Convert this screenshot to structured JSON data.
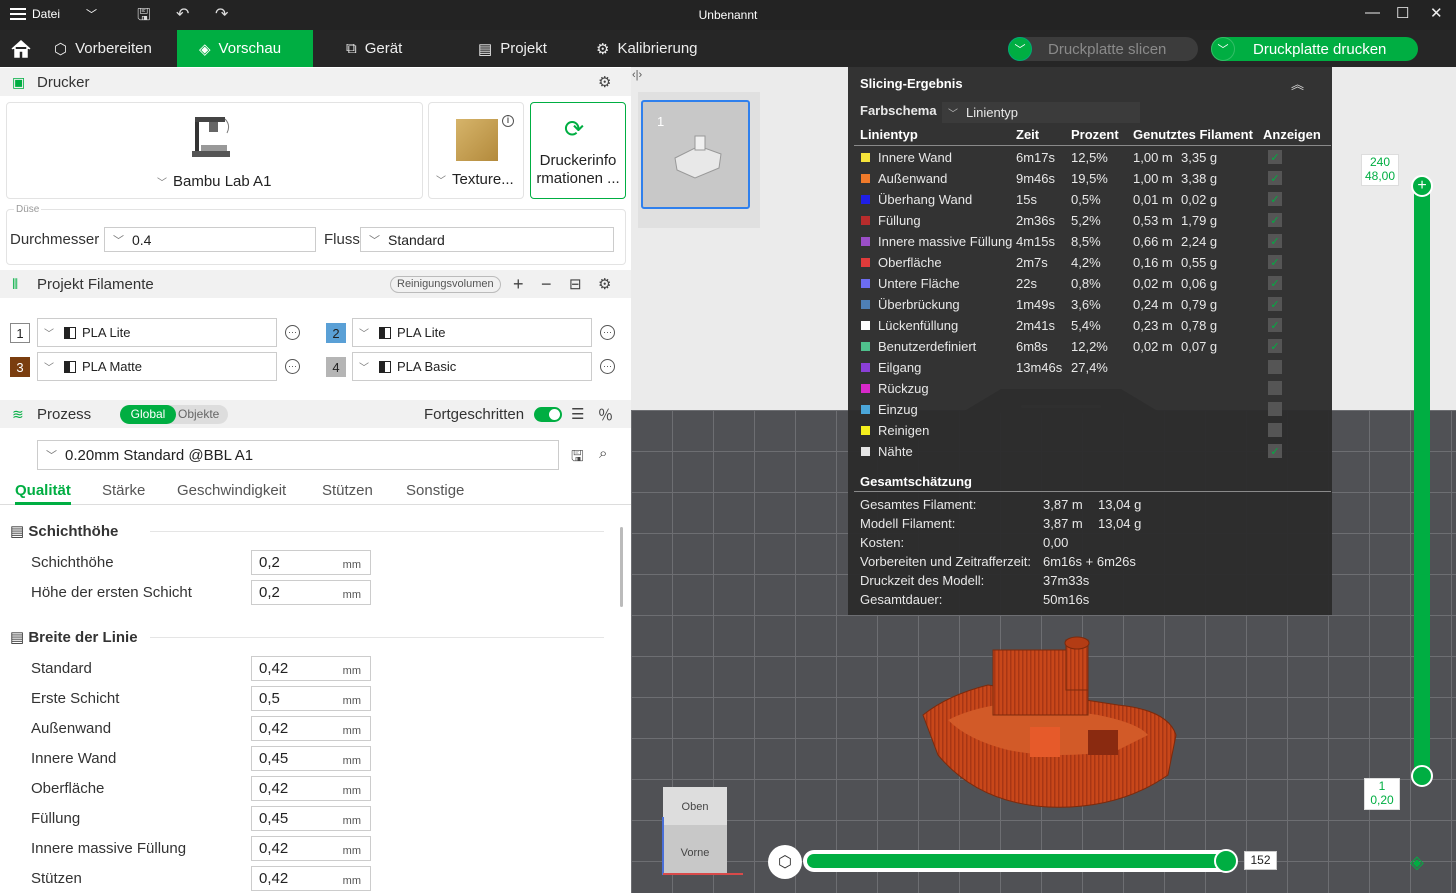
{
  "titlebar": {
    "menu_label": "Datei",
    "title": "Unbenannt"
  },
  "nav": {
    "items": [
      {
        "label": "Vorbereiten"
      },
      {
        "label": "Vorschau"
      },
      {
        "label": "Gerät"
      },
      {
        "label": "Projekt"
      },
      {
        "label": "Kalibrierung"
      }
    ],
    "slice_label": "Druckplatte slicen",
    "print_label": "Druckplatte drucken"
  },
  "printer": {
    "header": "Drucker",
    "name": "Bambu Lab A1",
    "plate": "Texture...",
    "info_label_1": "Druckerinfo",
    "info_label_2": "rmationen ..."
  },
  "nozzle": {
    "group_label": "Düse",
    "diameter_label": "Durchmesser",
    "diameter_value": "0.4",
    "flow_label": "Fluss",
    "flow_value": "Standard"
  },
  "filaments": {
    "header": "Projekt Filamente",
    "purge_label": "Reinigungsvolumen",
    "items": [
      {
        "num": "1",
        "name": "PLA Lite",
        "color": "#ffffff"
      },
      {
        "num": "2",
        "name": "PLA Lite",
        "color": "#5aa0d6"
      },
      {
        "num": "3",
        "name": "PLA Matte",
        "color": "#7a3d0f"
      },
      {
        "num": "4",
        "name": "PLA Basic",
        "color": "#b5b5b5"
      }
    ]
  },
  "process": {
    "header": "Prozess",
    "toggle_global": "Global",
    "toggle_objects": "Objekte",
    "advanced_label": "Fortgeschritten",
    "profile": "0.20mm Standard @BBL A1",
    "tabs": [
      "Qualität",
      "Stärke",
      "Geschwindigkeit",
      "Stützen",
      "Sonstige"
    ],
    "groups": [
      {
        "title": "Schichthöhe",
        "rows": [
          {
            "label": "Schichthöhe",
            "value": "0,2",
            "unit": "mm"
          },
          {
            "label": "Höhe der ersten Schicht",
            "value": "0,2",
            "unit": "mm"
          }
        ]
      },
      {
        "title": "Breite der Linie",
        "rows": [
          {
            "label": "Standard",
            "value": "0,42",
            "unit": "mm"
          },
          {
            "label": "Erste Schicht",
            "value": "0,5",
            "unit": "mm"
          },
          {
            "label": "Außenwand",
            "value": "0,42",
            "unit": "mm"
          },
          {
            "label": "Innere Wand",
            "value": "0,45",
            "unit": "mm"
          },
          {
            "label": "Oberfläche",
            "value": "0,42",
            "unit": "mm"
          },
          {
            "label": "Füllung",
            "value": "0,45",
            "unit": "mm"
          },
          {
            "label": "Innere massive Füllung",
            "value": "0,42",
            "unit": "mm"
          },
          {
            "label": "Stützen",
            "value": "0,42",
            "unit": "mm"
          }
        ]
      }
    ]
  },
  "viewport": {
    "plate_number": "1",
    "cube_top": "Oben",
    "cube_front": "Vorne",
    "layer_top_num": "240",
    "layer_top_height": "48,00",
    "layer_bottom_num": "1",
    "layer_bottom_height": "0,20",
    "move_value": "152"
  },
  "result": {
    "title": "Slicing-Ergebnis",
    "scheme_label": "Farbschema",
    "scheme_value": "Linientyp",
    "columns": [
      "Linientyp",
      "Zeit",
      "Prozent",
      "Genutztes Filament",
      "Anzeigen"
    ],
    "rows": [
      {
        "name": "Innere Wand",
        "color": "#f5e33a",
        "time": "6m17s",
        "pct": "12,5%",
        "m": "1,00 m",
        "g": "3,35 g",
        "show": true
      },
      {
        "name": "Außenwand",
        "color": "#f07a2a",
        "time": "9m46s",
        "pct": "19,5%",
        "m": "1,00 m",
        "g": "3,38 g",
        "show": true
      },
      {
        "name": "Überhang Wand",
        "color": "#1f1fe6",
        "time": "15s",
        "pct": "0,5%",
        "m": "0,01 m",
        "g": "0,02 g",
        "show": true
      },
      {
        "name": "Füllung",
        "color": "#b82c2c",
        "time": "2m36s",
        "pct": "5,2%",
        "m": "0,53 m",
        "g": "1,79 g",
        "show": true
      },
      {
        "name": "Innere massive Füllung",
        "color": "#9b4fc8",
        "time": "4m15s",
        "pct": "8,5%",
        "m": "0,66 m",
        "g": "2,24 g",
        "show": true
      },
      {
        "name": "Oberfläche",
        "color": "#e03b3b",
        "time": "2m7s",
        "pct": "4,2%",
        "m": "0,16 m",
        "g": "0,55 g",
        "show": true
      },
      {
        "name": "Untere Fläche",
        "color": "#6c6cf0",
        "time": "22s",
        "pct": "0,8%",
        "m": "0,02 m",
        "g": "0,06 g",
        "show": true
      },
      {
        "name": "Überbrückung",
        "color": "#4e7fb5",
        "time": "1m49s",
        "pct": "3,6%",
        "m": "0,24 m",
        "g": "0,79 g",
        "show": true
      },
      {
        "name": "Lückenfüllung",
        "color": "#ffffff",
        "time": "2m41s",
        "pct": "5,4%",
        "m": "0,23 m",
        "g": "0,78 g",
        "show": true
      },
      {
        "name": "Benutzerdefiniert",
        "color": "#4fc08c",
        "time": "6m8s",
        "pct": "12,2%",
        "m": "0,02 m",
        "g": "0,07 g",
        "show": true
      },
      {
        "name": "Eilgang",
        "color": "#8a3fd6",
        "time": "13m46s",
        "pct": "27,4%",
        "m": "",
        "g": "",
        "show": false
      },
      {
        "name": "Rückzug",
        "color": "#d829c9",
        "time": "",
        "pct": "",
        "m": "",
        "g": "",
        "show": false
      },
      {
        "name": "Einzug",
        "color": "#4ba6d9",
        "time": "",
        "pct": "",
        "m": "",
        "g": "",
        "show": false
      },
      {
        "name": "Reinigen",
        "color": "#f4ee1d",
        "time": "",
        "pct": "",
        "m": "",
        "g": "",
        "show": false
      },
      {
        "name": "Nähte",
        "color": "#e6e6e6",
        "time": "",
        "pct": "",
        "m": "",
        "g": "",
        "show": true
      }
    ],
    "totals_title": "Gesamtschätzung",
    "totals": [
      {
        "k": "Gesamtes Filament:",
        "v1": "3,87 m",
        "v2": "13,04 g"
      },
      {
        "k": "Modell Filament:",
        "v1": "3,87 m",
        "v2": "13,04 g"
      },
      {
        "k": "Kosten:",
        "v1": "0,00",
        "v2": ""
      },
      {
        "k": "Vorbereiten und Zeitrafferzeit:",
        "v1": "6m16s + 6m26s",
        "v2": ""
      },
      {
        "k": "Druckzeit des Modell:",
        "v1": "37m33s",
        "v2": ""
      },
      {
        "k": "Gesamtdauer:",
        "v1": "50m16s",
        "v2": ""
      }
    ]
  },
  "colors": {
    "accent": "#00ae42",
    "model": "#c8471a"
  }
}
